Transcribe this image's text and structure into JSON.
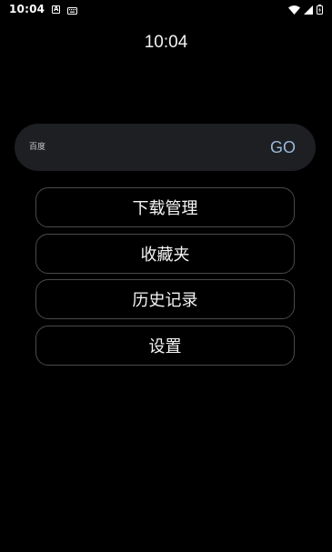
{
  "status_bar": {
    "time": "10:04",
    "notification_icon": "a-box-icon",
    "keyboard_icon": "keyboard-icon",
    "right_icons": [
      "wifi-icon",
      "signal-icon",
      "battery-icon"
    ]
  },
  "clock": {
    "time": "10:04"
  },
  "search": {
    "placeholder": "百度",
    "value": "",
    "go_label": "GO"
  },
  "menu": {
    "items": [
      {
        "label": "下载管理"
      },
      {
        "label": "收藏夹"
      },
      {
        "label": "历史记录"
      },
      {
        "label": "设置"
      }
    ]
  },
  "colors": {
    "background": "#000000",
    "search_bg": "#1d1f22",
    "go_accent": "#9bb8dd",
    "button_border": "#4a4a4a"
  }
}
